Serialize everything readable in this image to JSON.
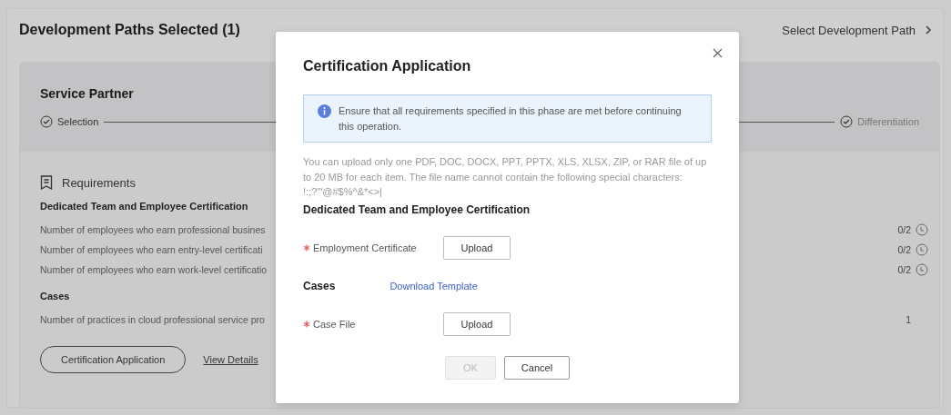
{
  "page": {
    "title": "Development Paths Selected (1)",
    "link": "Select Development Path"
  },
  "path": {
    "name": "Service Partner",
    "steps": [
      {
        "label": "Selection",
        "done": true
      },
      {
        "label": "Differentiation",
        "done": true
      }
    ]
  },
  "requirements": {
    "title": "Requirements",
    "groups": [
      {
        "title": "Dedicated Team and Employee Certification",
        "items": [
          {
            "text": "Number of employees who earn professional busines",
            "value": "0/2",
            "pending": true
          },
          {
            "text": "Number of employees who earn entry-level certificati",
            "value": "0/2",
            "pending": true
          },
          {
            "text": "Number of employees who earn work-level certificatio",
            "value": "0/2",
            "pending": true
          }
        ]
      },
      {
        "title": "Cases",
        "items": [
          {
            "text": "Number of practices in cloud professional service pro",
            "value": "1",
            "pending": false
          }
        ]
      }
    ]
  },
  "actions": {
    "primary": "Certification Application",
    "link": "View Details"
  },
  "dialog": {
    "title": "Certification Application",
    "notice": "Ensure that all requirements specified in this phase are met before continuing this operation.",
    "hint": "You can upload only one PDF, DOC, DOCX, PPT, PPTX, XLS, XLSX, ZIP, or RAR file of up to 20 MB for each item. The file name cannot contain the following special characters: !:;?'\"@#$%^&*<>|",
    "sections": [
      {
        "title": "Dedicated Team and Employee Certification",
        "fields": [
          {
            "label": "Employment Certificate",
            "required": true,
            "button": "Upload"
          }
        ]
      },
      {
        "title": "Cases",
        "link": "Download Template",
        "fields": [
          {
            "label": "Case File",
            "required": true,
            "button": "Upload"
          }
        ]
      }
    ],
    "buttons": [
      {
        "label": "OK",
        "disabled": true
      },
      {
        "label": "Cancel",
        "disabled": false
      }
    ]
  }
}
